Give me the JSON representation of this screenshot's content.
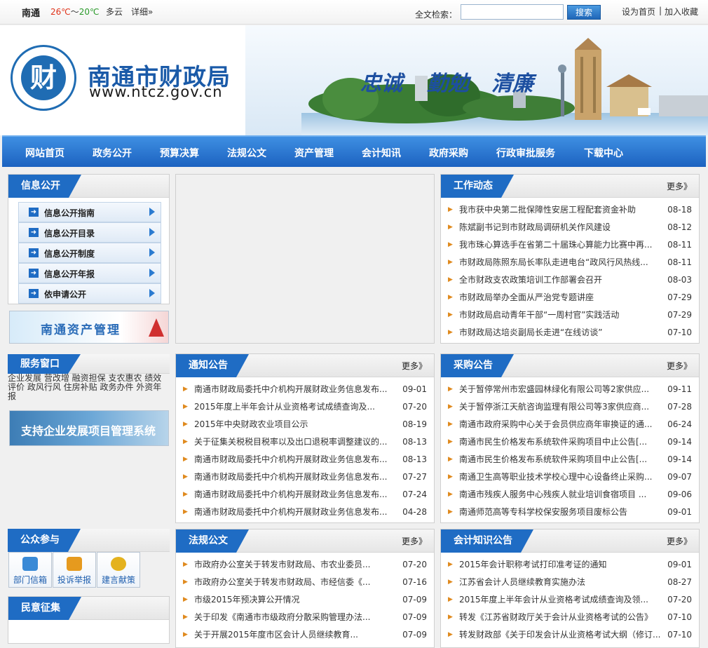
{
  "topbar": {
    "city": "南通",
    "temp_high": "26℃",
    "temp_sep": "～",
    "temp_low": "20℃",
    "weather": "多云",
    "detail": "详细»",
    "search_label": "全文检索：",
    "search_value": "",
    "search_button": "搜索",
    "set_home": "设为首页",
    "separator": "|",
    "add_favorite": "加入收藏"
  },
  "banner": {
    "seal_char": "财",
    "name": "南通市财政局",
    "url": "www.ntcz.gov.cn",
    "slogans": [
      "忠诚",
      "勤勉",
      "清廉"
    ]
  },
  "nav": [
    "网站首页",
    "政务公开",
    "预算决算",
    "法规公文",
    "资产管理",
    "会计知讯",
    "政府采购",
    "行政审批服务",
    "下载中心"
  ],
  "info_public": {
    "title": "信息公开",
    "items": [
      "信息公开指南",
      "信息公开目录",
      "信息公开制度",
      "信息公开年报",
      "依申请公开"
    ]
  },
  "ad_asset": "南通资产管理",
  "service": {
    "title": "服务窗口",
    "links_line1": "企业发展 营改增 融资担保 支农惠农 绩效",
    "links_line2": "评价 政风行风 住房补贴 政务办件 外资年",
    "links_line3": "报"
  },
  "ad_support": "支持企业发展项目管理系统",
  "public_participation": {
    "title": "公众参与",
    "boxes": [
      "部门信箱",
      "投诉举报",
      "建言献策"
    ]
  },
  "opinion": {
    "title": "民意征集"
  },
  "work_news": {
    "title": "工作动态",
    "more": "更多》",
    "rows": [
      {
        "t": "我市获中央第二批保障性安居工程配套资金补助",
        "d": "08-18"
      },
      {
        "t": "陈斌副书记到市财政局调研机关作风建设",
        "d": "08-12"
      },
      {
        "t": "我市珠心算选手在省第二十届珠心算能力比赛中再...",
        "d": "08-11"
      },
      {
        "t": "市财政局陈照东局长率队走进电台“政风行风热线...",
        "d": "08-11"
      },
      {
        "t": "全市财政支农政策培训工作部署会召开",
        "d": "08-03"
      },
      {
        "t": "市财政局举办全面从严治党专题讲座",
        "d": "07-29"
      },
      {
        "t": "市财政局启动青年干部“一周村官”实践活动",
        "d": "07-29"
      },
      {
        "t": "市财政局达培炎副局长走进“在线访谈”",
        "d": "07-10"
      }
    ]
  },
  "notice": {
    "title": "通知公告",
    "more": "更多》",
    "rows": [
      {
        "t": "南通市财政局委托中介机构开展财政业务信息发布...",
        "d": "09-01"
      },
      {
        "t": "2015年度上半年会计从业资格考试成绩查询及...",
        "d": "07-20"
      },
      {
        "t": "2015年中央财政农业项目公示",
        "d": "08-19"
      },
      {
        "t": "关于征集关税税目税率以及出口退税率调整建议的...",
        "d": "08-13"
      },
      {
        "t": "南通市财政局委托中介机构开展财政业务信息发布...",
        "d": "08-13"
      },
      {
        "t": "南通市财政局委托中介机构开展财政业务信息发布...",
        "d": "07-27"
      },
      {
        "t": "南通市财政局委托中介机构开展财政业务信息发布...",
        "d": "07-24"
      },
      {
        "t": "南通市财政局委托中介机构开展财政业务信息发布...",
        "d": "04-28"
      }
    ]
  },
  "purchase": {
    "title": "采购公告",
    "more": "更多》",
    "rows": [
      {
        "t": "关于暂停常州市宏盛园林绿化有限公司等2家供应...",
        "d": "09-11"
      },
      {
        "t": "关于暂停浙江天航咨询监理有限公司等3家供应商...",
        "d": "07-28"
      },
      {
        "t": "南通市政府采购中心关于会员供应商年审换证的通...",
        "d": "06-24"
      },
      {
        "t": "南通市民生价格发布系统软件采购项目中止公告[...",
        "d": "09-14"
      },
      {
        "t": "南通市民生价格发布系统软件采购项目中止公告[...",
        "d": "09-14"
      },
      {
        "t": "南通卫生高等职业技术学校心理中心设备终止采购...",
        "d": "09-07"
      },
      {
        "t": "南通市残疾人服务中心残疾人就业培训食宿项目 ...",
        "d": "09-06"
      },
      {
        "t": "南通师范高等专科学校保安服务项目废标公告",
        "d": "09-01"
      }
    ]
  },
  "regulations": {
    "title": "法规公文",
    "more": "更多》",
    "rows": [
      {
        "t": "市政府办公室关于转发市财政局、市农业委员...",
        "d": "07-20"
      },
      {
        "t": "市政府办公室关于转发市财政局、市经信委《...",
        "d": "07-16"
      },
      {
        "t": "市级2015年预决算公开情况",
        "d": "07-09"
      },
      {
        "t": "关于印发《南通市市级政府分散采购管理办法...",
        "d": "07-09"
      },
      {
        "t": "关于开展2015年度市区会计人员继续教育...",
        "d": "07-09"
      }
    ]
  },
  "accounting": {
    "title": "会计知识公告",
    "more": "更多》",
    "rows": [
      {
        "t": "2015年会计职称考试打印准考证的通知",
        "d": "09-01"
      },
      {
        "t": "江苏省会计人员继续教育实施办法",
        "d": "08-27"
      },
      {
        "t": "2015年度上半年会计从业资格考试成绩查询及领...",
        "d": "07-20"
      },
      {
        "t": "转发《江苏省财政厅关于会计从业资格考试的公告》",
        "d": "07-10"
      },
      {
        "t": "转发财政部《关于印发会计从业资格考试大纲（修订...",
        "d": "07-10"
      }
    ]
  }
}
